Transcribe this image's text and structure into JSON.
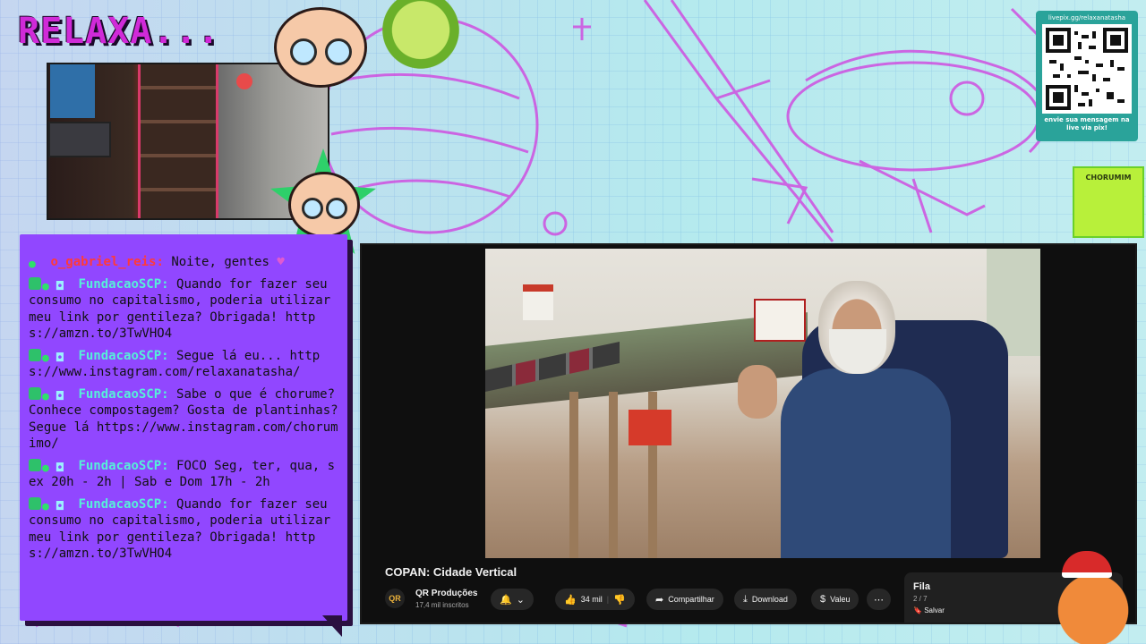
{
  "overlay": {
    "title": "RELAXA...",
    "qr_url": "livepix.gg/relaxanatasha",
    "qr_message": "envie sua mensagem na live via pix!",
    "side_badge": "CHORUMIM"
  },
  "chat": {
    "messages": [
      {
        "badges": [
          "alien"
        ],
        "user": "o_gabriel_reis:",
        "user_color": "#ff3a3a",
        "text": "Noite, gentes",
        "emote": "heart-emote"
      },
      {
        "badges": [
          "green",
          "alien",
          "robot"
        ],
        "user": "FundacaoSCP:",
        "user_color": "#56f0d8",
        "text": "Quando for fazer seu consumo no capitalismo, poderia utilizar meu link por gentileza? Obrigada! https://amzn.to/3TwVHO4"
      },
      {
        "badges": [
          "green",
          "alien",
          "robot"
        ],
        "user": "FundacaoSCP:",
        "user_color": "#56f0d8",
        "text": "Segue lá eu... https://www.instagram.com/relaxanatasha/"
      },
      {
        "badges": [
          "green",
          "alien",
          "robot"
        ],
        "user": "FundacaoSCP:",
        "user_color": "#56f0d8",
        "text": "Sabe o que é chorume? Conhece compostagem? Gosta de plantinhas? Segue lá https://www.instagram.com/chorumimo/"
      },
      {
        "badges": [
          "green",
          "alien",
          "robot"
        ],
        "user": "FundacaoSCP:",
        "user_color": "#56f0d8",
        "text": "FOCO Seg, ter, qua, sex 20h - 2h | Sab e Dom 17h - 2h"
      },
      {
        "badges": [
          "green",
          "alien",
          "robot"
        ],
        "user": "FundacaoSCP:",
        "user_color": "#56f0d8",
        "text": "Quando for fazer seu consumo no capitalismo, poderia utilizar meu link por gentileza? Obrigada! https://amzn.to/3TwVHO4"
      }
    ]
  },
  "player": {
    "video_title": "COPAN: Cidade Vertical",
    "channel_logo": "QR",
    "channel_name": "QR Produções",
    "channel_subs": "17,4 mil inscritos",
    "bell_label": "",
    "like_count": "34 mil",
    "share_label": "Compartilhar",
    "download_label": "Download",
    "thanks_label": "Valeu",
    "more_label": "⋯",
    "queue_title": "Fila",
    "queue_count": "2 / 7",
    "save_label": "Salvar"
  },
  "icons": {
    "bell": "🔔",
    "like": "👍",
    "dislike": "👎",
    "share": "➦",
    "download": "⤓",
    "thanks": "$",
    "save": "🔖"
  },
  "colors": {
    "accent": "#9147ff",
    "title": "#d02ad8",
    "qr_card": "#2aa39a",
    "player_bg": "#0f0f0f"
  }
}
